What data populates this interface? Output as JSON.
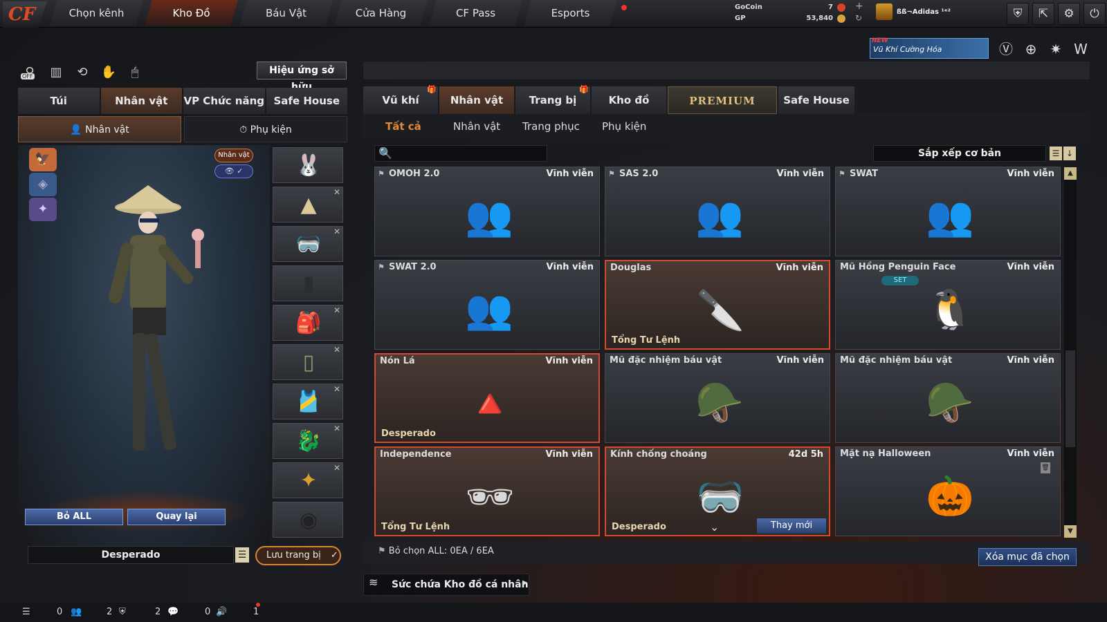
{
  "nav": {
    "logo": "CF",
    "tabs": [
      "Chọn kênh",
      "Kho Đồ",
      "Báu Vật",
      "Cửa Hàng",
      "CF Pass",
      "Esports"
    ],
    "active_tab": "Kho Đồ"
  },
  "currency": {
    "gocoin_label": "GoCoin",
    "gp_label": "GP",
    "gocoin_value": "7",
    "gp_value": "53,840"
  },
  "user": {
    "name": "ßß¬Adidas ¹ᵉ²"
  },
  "promo": {
    "badge": "NEW",
    "text": "Vũ Khí Cường Hóa"
  },
  "left": {
    "effects_button": "Hiệu ứng sở hữu",
    "off_label": "OFF",
    "tabs": [
      "Túi",
      "Nhân vật",
      "VP Chức năng",
      "Safe House"
    ],
    "active_tab": "Nhân vật",
    "subtabs": [
      "Nhân vật",
      "Phụ kiện"
    ],
    "active_subtab": "Nhân vật",
    "badge_character": "Nhân vật ✓",
    "badge_view": "👁 ✓",
    "btn_remove_all": "Bỏ ALL",
    "btn_back": "Quay lại",
    "preset_name": "Desperado",
    "save_button": "Lưu trang bị"
  },
  "right": {
    "tabs": [
      "Vũ khí",
      "Nhân vật",
      "Trang bị",
      "Kho đồ",
      "PREMIUM",
      "Safe House"
    ],
    "active_tab": "Nhân vật",
    "filters": [
      "Tất cả",
      "Nhân vật",
      "Trang phục",
      "Phụ kiện"
    ],
    "active_filter": "Tất cả",
    "search_value": "",
    "sort_label": "Sắp xếp cơ bản",
    "items": [
      {
        "name": "OMOH 2.0",
        "duration": "Vĩnh viễn",
        "owner": "",
        "pinned": true,
        "selected": false,
        "pic": "👥",
        "set": "",
        "renew": ""
      },
      {
        "name": "SAS 2.0",
        "duration": "Vĩnh viễn",
        "owner": "",
        "pinned": true,
        "selected": false,
        "pic": "👥",
        "set": "",
        "renew": ""
      },
      {
        "name": "SWAT",
        "duration": "Vĩnh viễn",
        "owner": "",
        "pinned": true,
        "selected": false,
        "pic": "👥",
        "set": "",
        "renew": ""
      },
      {
        "name": "SWAT 2.0",
        "duration": "Vĩnh viễn",
        "owner": "",
        "pinned": true,
        "selected": false,
        "pic": "👥",
        "set": "",
        "renew": ""
      },
      {
        "name": "Douglas",
        "duration": "Vĩnh viễn",
        "owner": "Tổng Tư Lệnh",
        "pinned": false,
        "selected": true,
        "pic": "🔪",
        "set": "",
        "renew": ""
      },
      {
        "name": "Mũ Hồng Penguin Face",
        "duration": "Vĩnh viễn",
        "owner": "",
        "pinned": false,
        "selected": false,
        "pic": "🐧",
        "set": "SET",
        "renew": ""
      },
      {
        "name": "Nón Lá",
        "duration": "Vĩnh viễn",
        "owner": "Desperado",
        "pinned": false,
        "selected": true,
        "pic": "🔺",
        "set": "",
        "renew": ""
      },
      {
        "name": "Mũ đặc nhiệm báu vật",
        "duration": "Vĩnh viễn",
        "owner": "",
        "pinned": false,
        "selected": false,
        "pic": "🪖",
        "set": "",
        "renew": ""
      },
      {
        "name": "Mũ đặc nhiệm báu vật",
        "duration": "Vĩnh viễn",
        "owner": "",
        "pinned": false,
        "selected": false,
        "pic": "🪖",
        "set": "",
        "renew": ""
      },
      {
        "name": "Independence",
        "duration": "Vĩnh viễn",
        "owner": "Tổng Tư Lệnh",
        "pinned": false,
        "selected": true,
        "pic": "🕶",
        "set": "",
        "renew": ""
      },
      {
        "name": "Kính chống choáng",
        "duration": "42d 5h",
        "owner": "Desperado",
        "pinned": false,
        "selected": true,
        "pic": "🥽",
        "set": "",
        "renew": "Thay mới"
      },
      {
        "name": "Mặt nạ Halloween",
        "duration": "Vĩnh viễn",
        "owner": "",
        "pinned": false,
        "selected": false,
        "pic": "🎃",
        "set": "",
        "renew": ""
      }
    ],
    "deselect_text": "Bỏ chọn ALL: 0EA / 6EA",
    "delete_button": "Xóa mục đã chọn",
    "capacity_label": "Sức chứa Kho đồ cá nhân"
  },
  "status": {
    "friends": "0",
    "clan": "2",
    "chat": "2",
    "voice": "0",
    "notify": "1"
  },
  "colors": {
    "accent": "#d24a30",
    "button_blue": "#2b3f6e",
    "gold": "#e0c080"
  }
}
